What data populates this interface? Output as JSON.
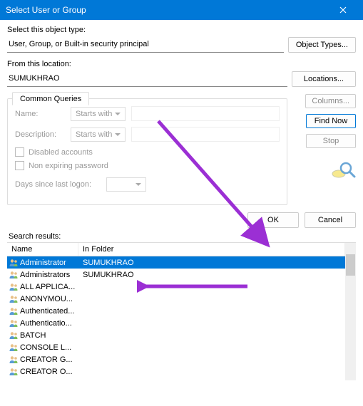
{
  "window": {
    "title": "Select User or Group"
  },
  "objectType": {
    "label": "Select this object type:",
    "value": "User, Group, or Built-in security principal",
    "button": "Object Types..."
  },
  "location": {
    "label": "From this location:",
    "value": "SUMUKHRAO",
    "button": "Locations..."
  },
  "tabs": {
    "common": "Common Queries"
  },
  "query": {
    "nameLabel": "Name:",
    "descLabel": "Description:",
    "startsWith": "Starts with",
    "disabled": "Disabled accounts",
    "nonexpiring": "Non expiring password",
    "daysLabel": "Days since last logon:"
  },
  "buttons": {
    "columns": "Columns...",
    "findNow": "Find Now",
    "stop": "Stop",
    "ok": "OK",
    "cancel": "Cancel"
  },
  "results": {
    "label": "Search results:",
    "colName": "Name",
    "colFolder": "In Folder",
    "rows": [
      {
        "name": "Administrator",
        "folder": "SUMUKHRAO"
      },
      {
        "name": "Administrators",
        "folder": "SUMUKHRAO"
      },
      {
        "name": "ALL APPLICA...",
        "folder": ""
      },
      {
        "name": "ANONYMOU...",
        "folder": ""
      },
      {
        "name": "Authenticated...",
        "folder": ""
      },
      {
        "name": "Authenticatio...",
        "folder": ""
      },
      {
        "name": "BATCH",
        "folder": ""
      },
      {
        "name": "CONSOLE L...",
        "folder": ""
      },
      {
        "name": "CREATOR G...",
        "folder": ""
      },
      {
        "name": "CREATOR O...",
        "folder": ""
      }
    ]
  },
  "colors": {
    "accent": "#0078d7",
    "arrow": "#9b2fd4"
  }
}
